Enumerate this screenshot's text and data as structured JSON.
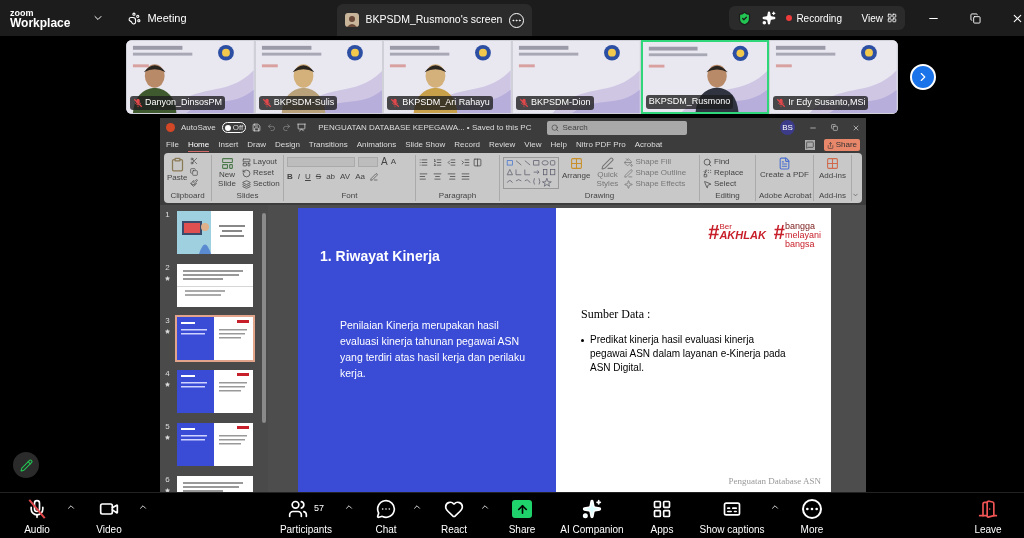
{
  "app": {
    "logo_line1": "zoom",
    "logo_line2": "Workplace"
  },
  "top_bar": {
    "meeting": "Meeting",
    "share_tab": "BKPSDM_Rusmono's screen",
    "recording": "Recording",
    "view": "View"
  },
  "participants": [
    {
      "name": "Danyon_DinsosPM",
      "muted": true,
      "selected": false
    },
    {
      "name": "BKPSDM-Sulis",
      "muted": true,
      "selected": false
    },
    {
      "name": "BKPSDM_Ari Rahayu",
      "muted": true,
      "selected": false
    },
    {
      "name": "BKPSDM-Dion",
      "muted": true,
      "selected": false
    },
    {
      "name": "BKPSDM_Rusmono",
      "muted": false,
      "selected": true
    },
    {
      "name": "Ir Edy Susanto,MSi",
      "muted": true,
      "selected": false
    }
  ],
  "powerpoint": {
    "autosave": "AutoSave",
    "autosave_on": false,
    "autosave_state": "Off",
    "title": "PENGUATAN DATABASE KEPEGAWA... • Saved to this PC",
    "search_placeholder": "Search",
    "account": "BS",
    "share": "Share",
    "tabs": [
      {
        "label": "File",
        "selected": false
      },
      {
        "label": "Home",
        "selected": true
      },
      {
        "label": "Insert",
        "selected": false
      },
      {
        "label": "Draw",
        "selected": false
      },
      {
        "label": "Design",
        "selected": false
      },
      {
        "label": "Transitions",
        "selected": false
      },
      {
        "label": "Animations",
        "selected": false
      },
      {
        "label": "Slide Show",
        "selected": false
      },
      {
        "label": "Record",
        "selected": false
      },
      {
        "label": "Review",
        "selected": false
      },
      {
        "label": "View",
        "selected": false
      },
      {
        "label": "Help",
        "selected": false
      },
      {
        "label": "Nitro PDF Pro",
        "selected": false
      },
      {
        "label": "Acrobat",
        "selected": false
      }
    ],
    "ribbon": {
      "clipboard": {
        "label": "Clipboard",
        "paste": "Paste"
      },
      "slides": {
        "label": "Slides",
        "new_slide": "New Slide",
        "layout": "Layout",
        "reset": "Reset",
        "section": "Section"
      },
      "font": {
        "label": "Font",
        "grow": "A",
        "shrink": "A",
        "buttons": [
          "B",
          "I",
          "U",
          "S",
          "ab",
          "AV",
          "Aa"
        ]
      },
      "paragraph": {
        "label": "Paragraph"
      },
      "drawing": {
        "label": "Drawing",
        "arrange": "Arrange",
        "quick_styles": "Quick Styles",
        "shape_fill": "Shape Fill",
        "shape_outline": "Shape Outline",
        "shape_effects": "Shape Effects"
      },
      "editing": {
        "label": "Editing",
        "find": "Find",
        "replace": "Replace",
        "select": "Select"
      },
      "acrobat": {
        "label": "Adobe Acrobat",
        "create_pdf": "Create a PDF"
      },
      "addins": {
        "label": "Add-ins",
        "addins": "Add-ins"
      }
    }
  },
  "slides": [
    {
      "number": "1",
      "kind": "title",
      "transition": false,
      "selected": false
    },
    {
      "number": "2",
      "kind": "text",
      "transition": true,
      "selected": false
    },
    {
      "number": "3",
      "kind": "split",
      "transition": true,
      "selected": true
    },
    {
      "number": "4",
      "kind": "split",
      "transition": true,
      "selected": false
    },
    {
      "number": "5",
      "kind": "split",
      "transition": true,
      "selected": false
    },
    {
      "number": "6",
      "kind": "text",
      "transition": true,
      "selected": false
    }
  ],
  "slide": {
    "title": "1. Riwayat Kinerja",
    "body": "Penilaian Kinerja merupakan hasil evaluasi kinerja tahunan pegawai ASN yang terdiri atas hasil kerja dan perilaku kerja.",
    "source_heading": "Sumber Data :",
    "bullets": [
      "Predikat kinerja hasil evaluasi kinerja pegawai ASN dalam layanan e-Kinerja pada ASN Digital."
    ],
    "logo_akhlak": {
      "hash": "#",
      "prefix": "Ber",
      "word": "AKHLAK"
    },
    "logo_bangga": {
      "hash": "#",
      "words": [
        "bangga",
        "melayani",
        "bangsa"
      ]
    },
    "footer": "Penguatan Database ASN"
  },
  "toolbar": [
    {
      "label": "Audio",
      "kind": "audio",
      "muted": true,
      "caret": true
    },
    {
      "label": "Video",
      "kind": "video",
      "caret": true
    },
    {
      "label": "Participants",
      "kind": "participants",
      "count": "57",
      "caret": true
    },
    {
      "label": "Chat",
      "kind": "chat",
      "caret": true
    },
    {
      "label": "React",
      "kind": "react",
      "caret": true
    },
    {
      "label": "Share",
      "kind": "share",
      "caret": false
    },
    {
      "label": "AI Companion",
      "kind": "ai",
      "caret": false
    },
    {
      "label": "Apps",
      "kind": "apps",
      "caret": false
    },
    {
      "label": "Show captions",
      "kind": "captions",
      "caret": true
    },
    {
      "label": "More",
      "kind": "more",
      "caret": false
    },
    {
      "label": "Leave",
      "kind": "leave",
      "caret": false
    }
  ]
}
